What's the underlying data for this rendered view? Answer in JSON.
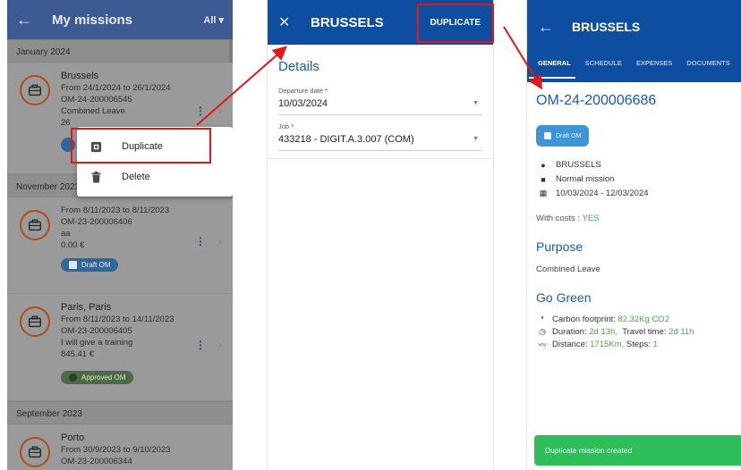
{
  "list_panel": {
    "title": "My missions",
    "filter": "All",
    "groups": [
      {
        "label": "January 2024",
        "items": [
          {
            "name": "Brussels",
            "dates": "From 24/1/2024 to 26/1/2024",
            "number": "OM-24-200006545",
            "purpose": "Combined Leave",
            "amount": "26"
          }
        ]
      },
      {
        "label": "November 2023",
        "items": [
          {
            "name": "",
            "dates": "From 8/11/2023 to 8/11/2023",
            "number": "OM-23-200006406",
            "purpose": "aa",
            "amount": "0.00 €",
            "status": "Draft OM"
          },
          {
            "name": "Paris, Paris",
            "dates": "From 8/11/2023 to 14/11/2023",
            "number": "OM-23-200006405",
            "purpose": "I will give a training",
            "amount": "845.41 €",
            "status": "Approved OM"
          }
        ]
      },
      {
        "label": "September 2023",
        "items": [
          {
            "name": "Porto",
            "dates": "From 30/9/2023 to 9/10/2023",
            "number": "OM-23-200006344"
          }
        ]
      }
    ],
    "context_menu": {
      "duplicate": "Duplicate",
      "delete": "Delete"
    }
  },
  "form_panel": {
    "title": "BRUSSELS",
    "action": "DUPLICATE",
    "section": "Details",
    "departure_label": "Departure date",
    "departure_value": "10/03/2024",
    "job_label": "Job",
    "job_value": "433218 - DIGIT.A.3.007 (COM)",
    "required_mark": "*"
  },
  "detail_panel": {
    "title": "BRUSSELS",
    "tabs": [
      "GENERAL",
      "SCHEDULE",
      "EXPENSES",
      "DOCUMENTS"
    ],
    "mission_number": "OM-24-200006686",
    "status": "Draft OM",
    "destination": "BRUSSELS",
    "mission_type": "Normal mission",
    "date_range": "10/03/2024 - 12/03/2024",
    "costs_label": "With costs :",
    "costs_value": "YES",
    "purpose_title": "Purpose",
    "purpose_value": "Combined Leave",
    "go_green_title": "Go Green",
    "carbon_label": "Carbon footprint:",
    "carbon_value": "82.32Kg CO2",
    "duration_label": "Duration:",
    "duration_value": "2d 13h,",
    "travel_label": "Travel time:",
    "travel_value": "2d 11h",
    "distance_label": "Distance:",
    "distance_value": "1715Km,",
    "steps_label": "Steps:",
    "steps_value": "1",
    "toast": "Duplicate mission created"
  },
  "colors": {
    "header_blue": "#0d4ea0",
    "accent_blue": "#1d5bab",
    "annotation_red": "#e01818",
    "success_green": "#2fbf5a",
    "mission_avatar": "#b34a19"
  },
  "icons": [
    "back-arrow-icon",
    "chevron-down-icon",
    "briefcase-icon",
    "kebab-icon",
    "chevron-right-icon",
    "duplicate-icon",
    "trash-icon",
    "close-icon",
    "pencil-icon",
    "check-circle-icon",
    "location-pin-icon",
    "suitcase-icon",
    "calendar-icon",
    "footprint-icon",
    "clock-icon",
    "trend-icon"
  ]
}
